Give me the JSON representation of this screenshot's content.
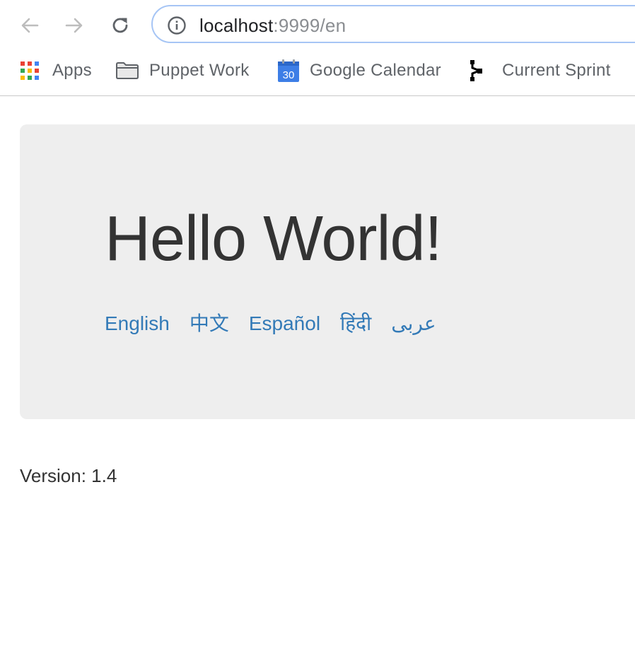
{
  "browser": {
    "url_host": "localhost",
    "url_rest": ":9999/en",
    "bookmarks": [
      {
        "label": "Apps",
        "icon": "apps-grid-icon"
      },
      {
        "label": "Puppet Work",
        "icon": "folder-icon"
      },
      {
        "label": "Google Calendar",
        "icon": "calendar-icon",
        "icon_text": "30"
      },
      {
        "label": "Current Sprint",
        "icon": "sprint-icon"
      }
    ],
    "colors": {
      "omnibox_border": "#a6c5f5",
      "calendar_blue": "#3d7ee6"
    }
  },
  "page": {
    "heading": "Hello World!",
    "languages": [
      {
        "label": "English"
      },
      {
        "label": "中文"
      },
      {
        "label": "Español"
      },
      {
        "label": "हिंदी"
      },
      {
        "label": "عربى"
      }
    ],
    "version": "Version: 1.4",
    "colors": {
      "link": "#337ab7",
      "jumbotron_bg": "#eeeeee",
      "text": "#333333"
    }
  }
}
